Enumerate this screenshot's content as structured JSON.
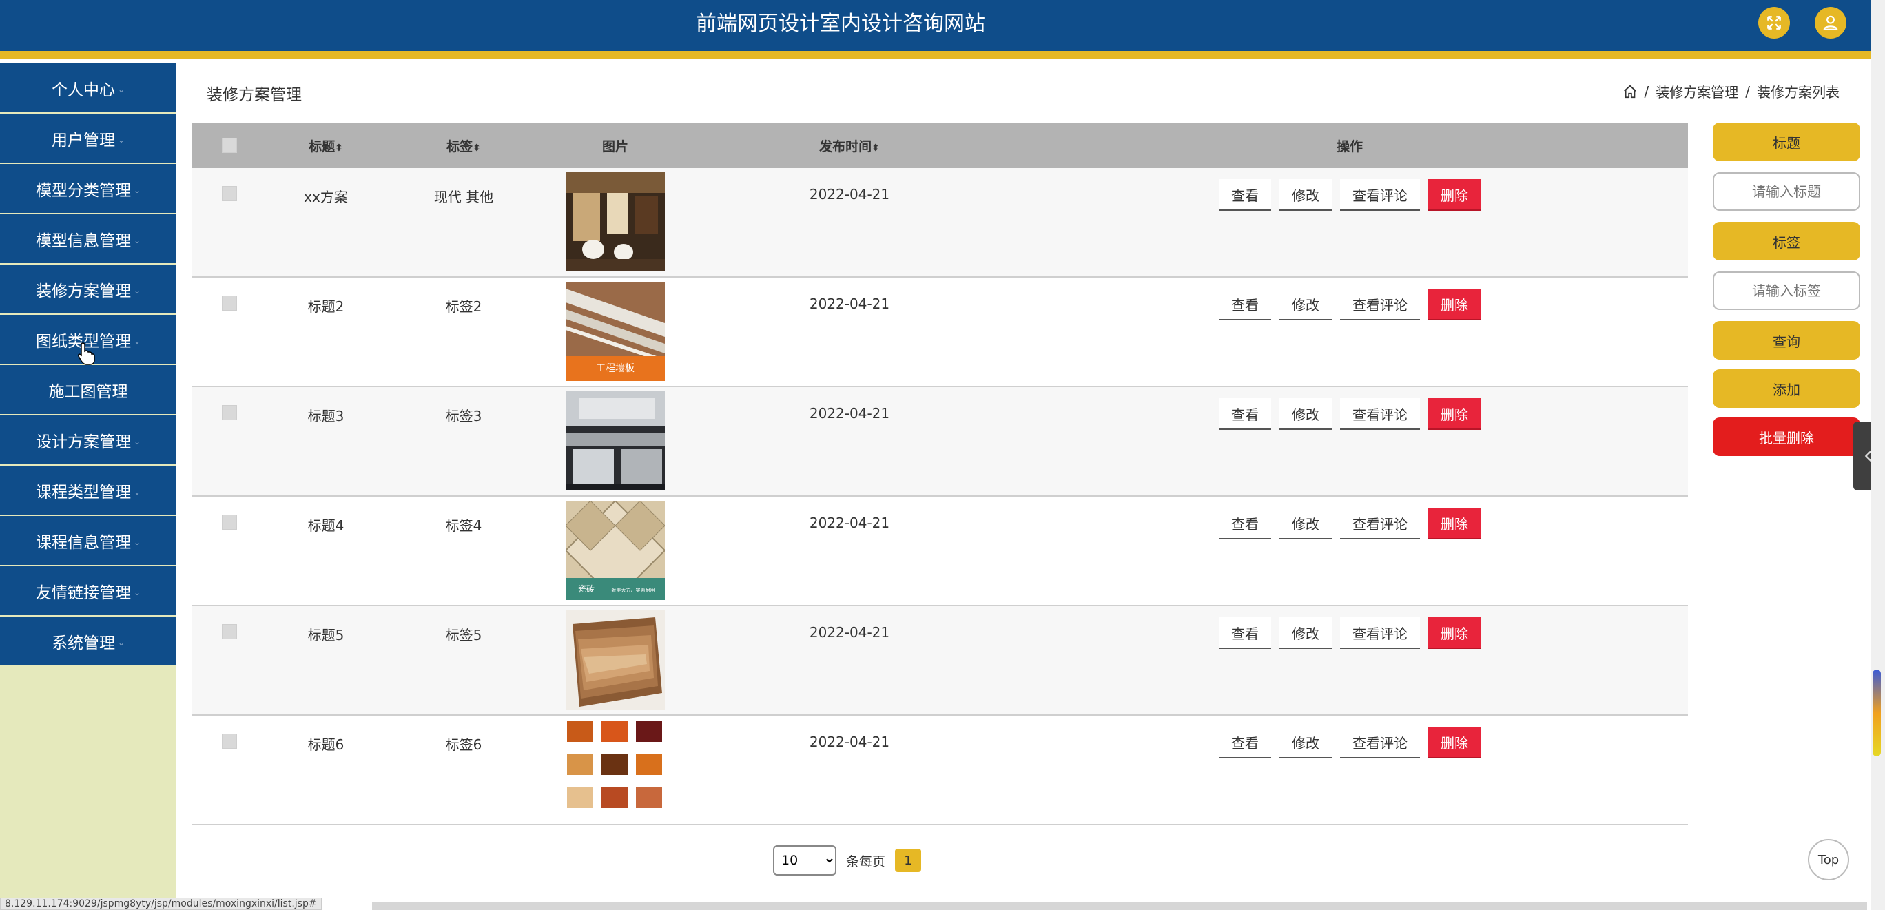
{
  "header": {
    "title": "前端网页设计室内设计咨询网站",
    "fullscreen_icon": "expand-icon",
    "user_icon": "user-icon"
  },
  "colors": {
    "primary": "#0f4d8a",
    "accent": "#e6b825",
    "danger": "#e8243b",
    "sidebar_bg": "#e5e9bc"
  },
  "sidebar": {
    "items": [
      {
        "label": "个人中心"
      },
      {
        "label": "用户管理"
      },
      {
        "label": "模型分类管理"
      },
      {
        "label": "模型信息管理"
      },
      {
        "label": "装修方案管理"
      },
      {
        "label": "图纸类型管理"
      },
      {
        "label": "施工图管理"
      },
      {
        "label": "设计方案管理"
      },
      {
        "label": "课程类型管理"
      },
      {
        "label": "课程信息管理"
      },
      {
        "label": "友情链接管理"
      },
      {
        "label": "系统管理"
      }
    ]
  },
  "page": {
    "title": "装修方案管理"
  },
  "breadcrumb": {
    "items": [
      "装修方案管理",
      "装修方案列表"
    ],
    "sep": "/"
  },
  "table": {
    "headers": {
      "title": "标题",
      "tag": "标签",
      "image": "图片",
      "date": "发布时间",
      "ops": "操作"
    },
    "rows": [
      {
        "title": "xx方案",
        "tag": "现代 其他",
        "image": "bathroom-showroom",
        "date": "2022-04-21"
      },
      {
        "title": "标题2",
        "tag": "标签2",
        "image": "wall-panel",
        "date": "2022-04-21"
      },
      {
        "title": "标题3",
        "tag": "标签3",
        "image": "kitchen-cabinets",
        "date": "2022-04-21"
      },
      {
        "title": "标题4",
        "tag": "标签4",
        "image": "ceramic-tiles",
        "date": "2022-04-21"
      },
      {
        "title": "标题5",
        "tag": "标签5",
        "image": "wood-samples",
        "date": "2022-04-21"
      },
      {
        "title": "标题6",
        "tag": "标签6",
        "image": "wood-color-grid",
        "date": "2022-04-21"
      }
    ],
    "ops": {
      "view": "查看",
      "edit": "修改",
      "comments": "查看评论",
      "delete": "删除"
    },
    "thumb_texts": {
      "wall_panel": "工程墙板",
      "tiles_badge": "瓷砖",
      "tiles_caption": "奢美大方、实惠耐用"
    }
  },
  "search": {
    "title_label": "标题",
    "title_placeholder": "请输入标题",
    "tag_label": "标签",
    "tag_placeholder": "请输入标签",
    "query": "查询",
    "add": "添加",
    "batch_delete": "批量删除"
  },
  "pager": {
    "page_size": "10",
    "per_page_label": "条每页",
    "current": "1"
  },
  "top_button": "Top",
  "status_url": "8.129.11.174:9029/jspmg8yty/jsp/modules/moxingxinxi/list.jsp#"
}
